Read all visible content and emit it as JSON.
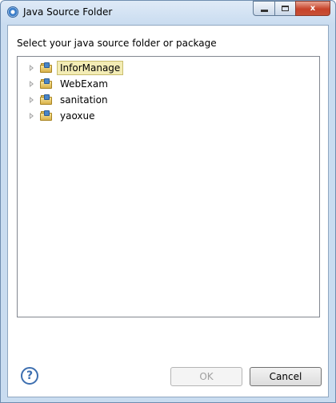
{
  "window": {
    "title": "Java Source Folder",
    "controls": {
      "minimize": "minimize",
      "maximize": "maximize",
      "close": "x"
    }
  },
  "dialog": {
    "prompt": "Select your java source folder or package",
    "tree": {
      "items": [
        {
          "label": "InforManage",
          "selected": true
        },
        {
          "label": "WebExam",
          "selected": false
        },
        {
          "label": "sanitation",
          "selected": false
        },
        {
          "label": "yaoxue",
          "selected": false
        }
      ]
    },
    "help_symbol": "?",
    "buttons": {
      "ok": "OK",
      "cancel": "Cancel",
      "ok_enabled": false
    }
  },
  "colors": {
    "selection_bg": "#f3ecb5",
    "titlebar": "#c9dcf0",
    "close_button": "#c7432a"
  }
}
